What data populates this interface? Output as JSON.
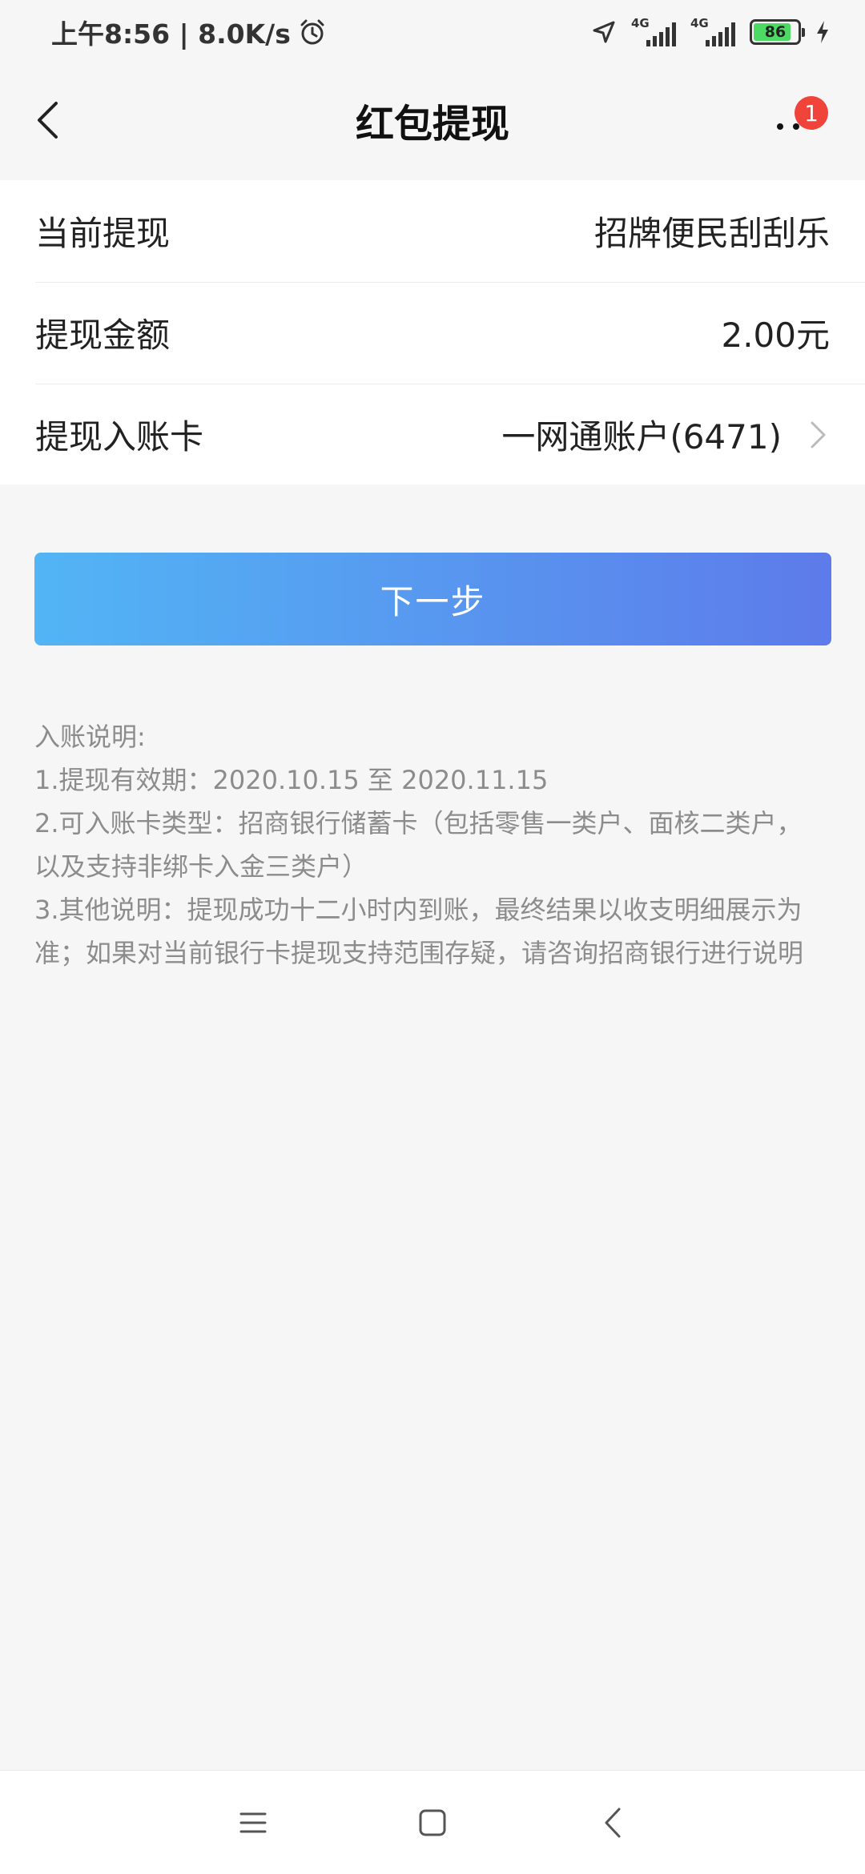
{
  "status_bar": {
    "time_speed": "上午8:56 | 8.0K/s",
    "sim1_label": "4G",
    "sim2_label": "4G",
    "battery_percent": "86",
    "battery_level": 0.86
  },
  "nav": {
    "title": "红包提现",
    "badge_count": "1"
  },
  "form": {
    "rows": [
      {
        "label": "当前提现",
        "value": "招牌便民刮刮乐"
      },
      {
        "label": "提现金额",
        "value": "2.00元"
      },
      {
        "label": "提现入账卡",
        "value": "一网通账户(6471)"
      }
    ]
  },
  "next_button_label": "下一步",
  "notes": {
    "title": "入账说明:",
    "lines": [
      "1.提现有效期：2020.10.15 至 2020.11.15",
      "2.可入账卡类型：招商银行储蓄卡（包括零售一类户、面核二类户，",
      "以及支持非绑卡入金三类户）",
      "3.其他说明：提现成功十二小时内到账，最终结果以收支明细展示为",
      "准；如果对当前银行卡提现支持范围存疑，请咨询招商银行进行说明"
    ]
  },
  "icons": {
    "back": "chevron-left-icon",
    "more": "more-icon",
    "alarm": "alarm-icon",
    "location": "location-icon",
    "charging": "charging-icon"
  },
  "colors": {
    "button_start": "#52b5f5",
    "button_end": "#5d7bea",
    "badge": "#f0433a",
    "battery_fill": "#4cd964"
  }
}
